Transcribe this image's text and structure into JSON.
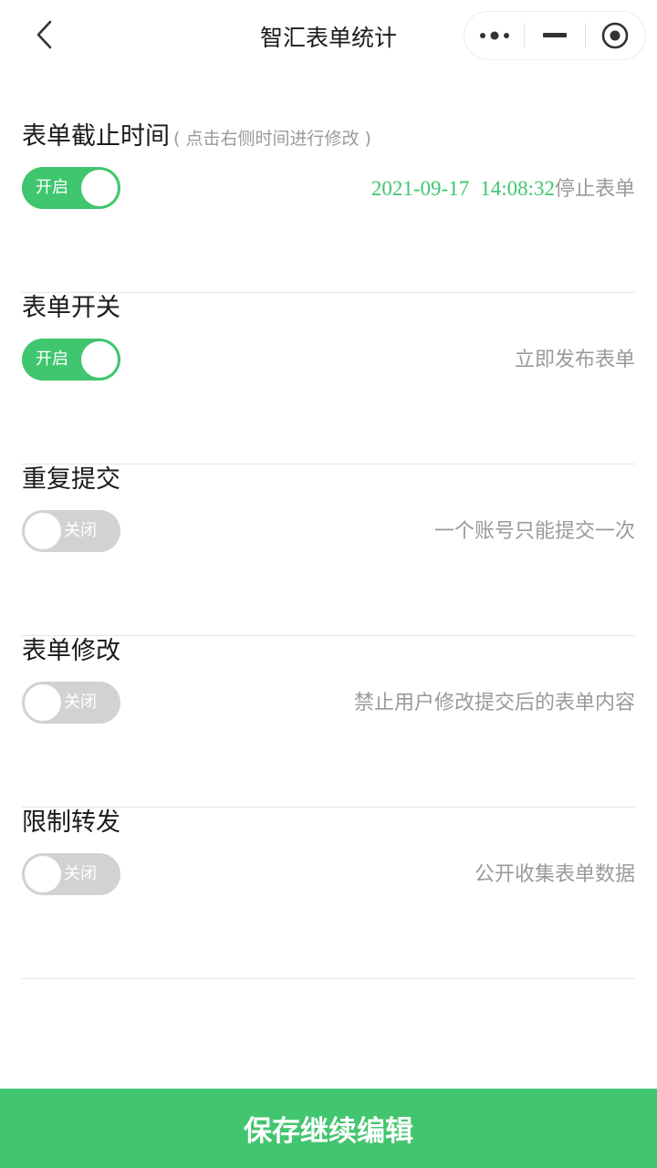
{
  "navbar": {
    "title": "智汇表单统计",
    "back_icon": "chevron-left-icon",
    "capsule": {
      "more_icon": "more-dots-icon",
      "minimize_icon": "minimize-icon",
      "close_icon": "target-close-icon"
    }
  },
  "settings": {
    "deadline": {
      "title": "表单截止时间",
      "hint": "( 点击右侧时间进行修改 )",
      "toggle_label": "开启",
      "enabled": true,
      "date": "2021-09-17",
      "time": "14:08:32",
      "action": "停止表单"
    },
    "form_switch": {
      "title": "表单开关",
      "toggle_label": "开启",
      "enabled": true,
      "description": "立即发布表单"
    },
    "repeat_submit": {
      "title": "重复提交",
      "toggle_label": "关闭",
      "enabled": false,
      "description": "一个账号只能提交一次"
    },
    "form_edit": {
      "title": "表单修改",
      "toggle_label": "关闭",
      "enabled": false,
      "description": "禁止用户修改提交后的表单内容"
    },
    "restrict_share": {
      "title": "限制转发",
      "toggle_label": "关闭",
      "enabled": false,
      "description": "公开收集表单数据"
    }
  },
  "footer": {
    "save_label": "保存继续编辑"
  },
  "colors": {
    "accent": "#3fc66f",
    "toggle_off": "#d2d2d2",
    "muted_text": "#9a9a9a",
    "save_button": "#42c56e"
  }
}
